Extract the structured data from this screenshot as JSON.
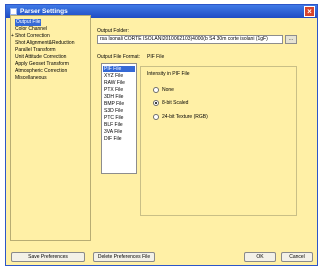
{
  "window": {
    "title": "Parser Settings",
    "close_glyph": "×"
  },
  "tree": {
    "items": [
      {
        "label": "Output File",
        "selected": true,
        "expander": ""
      },
      {
        "label": "Color Channel",
        "selected": false,
        "expander": ""
      },
      {
        "label": "Shot Correction",
        "selected": false,
        "expander": "+"
      },
      {
        "label": "Shot Alignment&Reduction",
        "selected": false,
        "expander": ""
      },
      {
        "label": "Parallel Transform",
        "selected": false,
        "expander": ""
      },
      {
        "label": "Unit Attitude Correction",
        "selected": false,
        "expander": ""
      },
      {
        "label": "Apply Geoset Transform",
        "selected": false,
        "expander": ""
      },
      {
        "label": "Atmospheric Correction",
        "selected": false,
        "expander": ""
      },
      {
        "label": "Miscellaneous",
        "selected": false,
        "expander": ""
      }
    ]
  },
  "output_folder": {
    "label": "Output Folder:",
    "value": "rsa Isonali CORTE ISOLANI2010062103)4000(b S4 30m corte isolani (1gF)",
    "browse_label": "..."
  },
  "output_format": {
    "label": "Output File Format:",
    "current": "PIF File",
    "options": [
      "PIF File",
      "XYZ File",
      "RAW File",
      "PTX File",
      "3DH File",
      "BMP File",
      "S3D File",
      "PTC File",
      "BLF File",
      "3VA File",
      "DIF File"
    ],
    "selected_index": 0
  },
  "intensity": {
    "label": "Intensity in PIF File",
    "options": [
      {
        "label": "None",
        "checked": false
      },
      {
        "label": "8-bit Scaled",
        "checked": true
      },
      {
        "label": "24-bit Texture (RGB)",
        "checked": false
      }
    ]
  },
  "buttons": {
    "save": "Save Preferences",
    "delete": "Delete Preferences File",
    "ok": "OK",
    "cancel": "Cancel"
  }
}
